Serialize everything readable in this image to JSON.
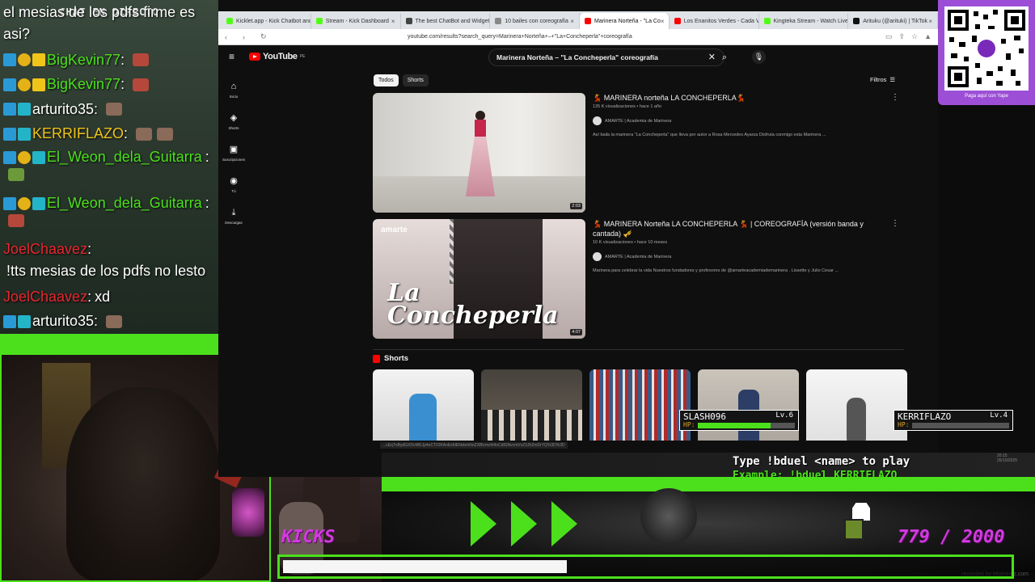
{
  "chat": {
    "header": "CHAT EN DIRECTO",
    "top_text": "el mesias de los pdfs firme es asi?",
    "lines": [
      {
        "user": "BigKevin77",
        "color": "#4ce01c",
        "sep": " :",
        "msg": ""
      },
      {
        "user": "BigKevin77",
        "color": "#4ce01c",
        "sep": " :",
        "msg": ""
      },
      {
        "user": "arturito35",
        "color": "#ffffff",
        "sep": " :",
        "msg": ""
      },
      {
        "user": "KERRIFLAZO",
        "color": "#f0c419",
        "sep": " :",
        "msg": ""
      },
      {
        "user": "El_Weon_dela_Guitarra",
        "color": "#4ce01c",
        "sep": "",
        "msg": ":"
      },
      {
        "user": "El_Weon_dela_Guitarra",
        "color": "#4ce01c",
        "sep": "",
        "msg": ":"
      },
      {
        "user": "JoelChaavez",
        "color": "#e8262f",
        "sep": " :",
        "msg": "!tts mesias de los pdfs no lesto memoso"
      },
      {
        "user": "JoelChaavez",
        "color": "#e8262f",
        "sep": " :",
        "msg": "xd"
      },
      {
        "user": "arturito35",
        "color": "#ffffff",
        "sep": " :",
        "msg": ""
      }
    ]
  },
  "browser": {
    "tabs": [
      {
        "label": "Kicklet.app - Kick Chatbot and",
        "color": "#53fc18"
      },
      {
        "label": "Stream - Kick Dashboard",
        "color": "#53fc18"
      },
      {
        "label": "The best ChatBot and Widgets",
        "color": "#444444"
      },
      {
        "label": "10 bailes con coreografía",
        "color": "#888888"
      },
      {
        "label": "Marinera Norteña - \"La Co",
        "color": "#ff0000"
      },
      {
        "label": "Los Enanitos Verdes - Cada Ve",
        "color": "#ff0000"
      },
      {
        "label": "Kingteka Stream - Watch Live",
        "color": "#53fc18"
      },
      {
        "label": "Arituku (@arituki) | TikTok",
        "color": "#111111"
      }
    ],
    "url": "youtube.com/results?search_query=Marinera+Norteña+–+\"La+Concheperla\"+coreografía"
  },
  "youtube": {
    "logo": "YouTube",
    "logo_sup": "PE",
    "search_value": "Marinera Norteña – \"La Concheperla\" coreografía",
    "sidebar": [
      {
        "icon": "⌂",
        "label": "Inicio",
        "icon_name": "home-icon"
      },
      {
        "icon": "◈",
        "label": "Shorts",
        "icon_name": "shorts-icon"
      },
      {
        "icon": "▣",
        "label": "Suscripciones",
        "icon_name": "subscriptions-icon"
      },
      {
        "icon": "◉",
        "label": "Tú",
        "icon_name": "you-icon"
      },
      {
        "icon": "⤓",
        "label": "Descargas",
        "icon_name": "download-icon"
      }
    ],
    "chips": [
      "Todos",
      "Shorts"
    ],
    "filters": "Filtros",
    "videos": [
      {
        "title": "💃 MARINERA norteña LA CONCHEPERLA💃",
        "meta": "135 K visualizaciones • hace 1 año",
        "channel": "AMARTE | Academia de Marinera",
        "desc": "Así baila la marinera \"La Concheperla\" que lleva por autor a Rosa Mercedes Ayarza Disfruta conmigo esta Marinera ...",
        "duration": "2:03"
      },
      {
        "title": "💃 MARINERA Norteña LA CONCHEPERLA 💃 | COREOGRAFÍA (versión banda y cantada) 🎺",
        "meta": "10 K visualizaciones • hace 10 meses",
        "channel": "AMARTE | Academia de Marinera",
        "desc": "Marinera para celebrar la vida Nuestros fundadores y profesores de @amarteacademiademarinera . Lissette y Julio Cesar ...",
        "duration": "4:07",
        "thumb_text": "La Concheperla",
        "thumb_logo": "amarte"
      }
    ],
    "shorts_label": "Shorts",
    "status_url": "...cEqTnBydGXDvWEJp4oCTIOKAnExhIENvbmNoZXBlcmxhl4oCdlGNvcmVvZ3JhZmDrYQ%3D%3D"
  },
  "qr": {
    "caption": "Paga aquí con Yape"
  },
  "overlay": {
    "bduel_line1": "Type !bduel <name> to play",
    "bduel_line2": "Example: !bduel KERRIFLAZO",
    "kicks_label": "KICKS",
    "kicks_count": "779 / 2000",
    "progress_fraction": 0.39,
    "cards": [
      {
        "name": "SLASH096",
        "level": "Lv.6",
        "hp_label": "HP:",
        "hp": 0.75
      },
      {
        "name": "KERRIFLAZO",
        "level": "Lv.4",
        "hp_label": "HP:",
        "hp": 0.0
      }
    ],
    "date": [
      "20:15",
      "26/10/2025"
    ],
    "watermark": "recorded by Momentz.com"
  }
}
